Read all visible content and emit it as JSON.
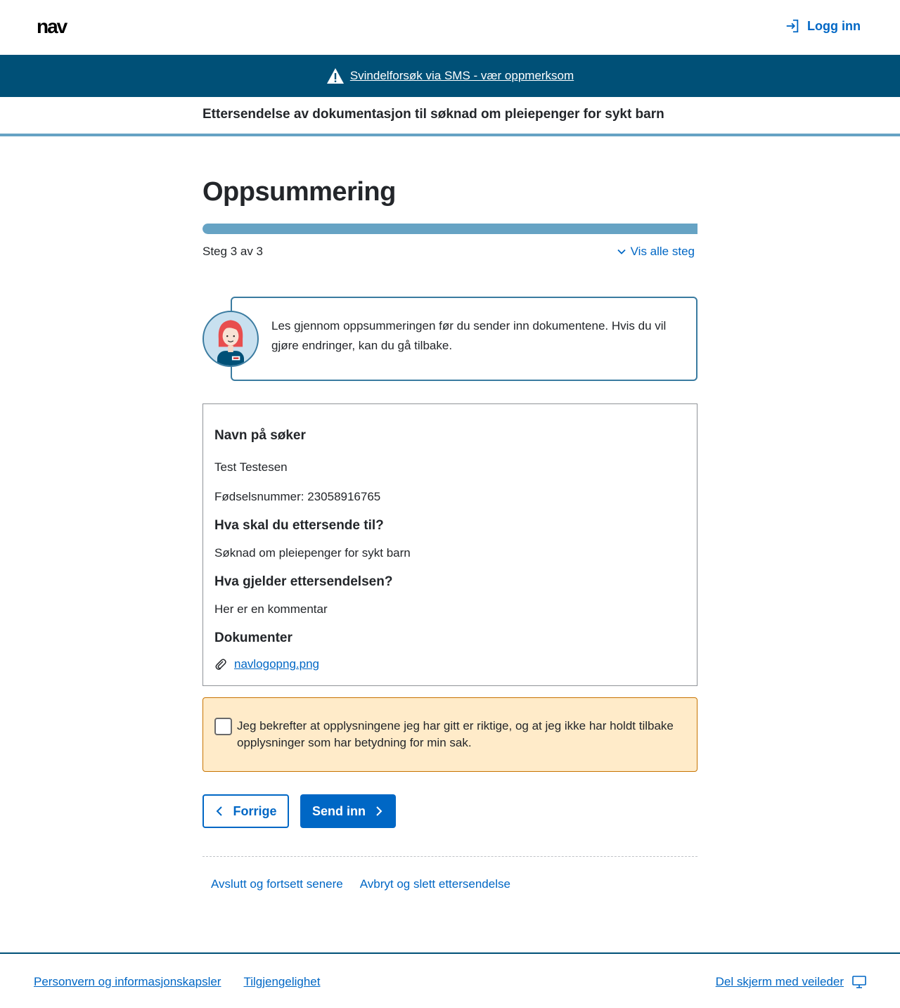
{
  "header": {
    "logo_text": "nav",
    "login_label": "Logg inn"
  },
  "alert": {
    "text": "Svindelforsøk via SMS - vær oppmerksom"
  },
  "form": {
    "title": "Ettersendelse av dokumentasjon til søknad om pleiepenger for sykt barn"
  },
  "page": {
    "heading": "Oppsummering",
    "progress_fraction": 1.0,
    "step_text": "Steg 3 av 3",
    "show_steps_label": "Vis alle steg"
  },
  "guide": {
    "text": "Les gjennom oppsummeringen før du sender inn dokumentene. Hvis du vil gjøre endringer, kan du gå tilbake."
  },
  "summary": {
    "applicant_heading": "Navn på søker",
    "applicant_name": "Test Testesen",
    "applicant_id": "Fødselsnummer: 23058916765",
    "target_heading": "Hva skal du ettersende til?",
    "target_value": "Søknad om pleiepenger for sykt barn",
    "about_heading": "Hva gjelder ettersendelsen?",
    "about_value": "Her er en kommentar",
    "docs_heading": "Dokumenter",
    "documents": [
      "navlogopng.png"
    ]
  },
  "confirm": {
    "label": "Jeg bekrefter at opplysningene jeg har gitt er riktige, og at jeg ikke har holdt tilbake opplysninger som har betydning for min sak.",
    "checked": false
  },
  "actions": {
    "previous_label": "Forrige",
    "submit_label": "Send inn",
    "save_later_label": "Avslutt og fortsett senere",
    "cancel_delete_label": "Avbryt og slett ettersendelse"
  },
  "footer": {
    "privacy_label": "Personvern og informasjonskapsler",
    "accessibility_label": "Tilgjengelighet",
    "share_screen_label": "Del skjerm med veileder"
  },
  "colors": {
    "primary": "#0067c5",
    "banner": "#005077",
    "progress": "#66a3c4",
    "confirm_bg": "#ffebc9",
    "confirm_border": "#c77300"
  }
}
